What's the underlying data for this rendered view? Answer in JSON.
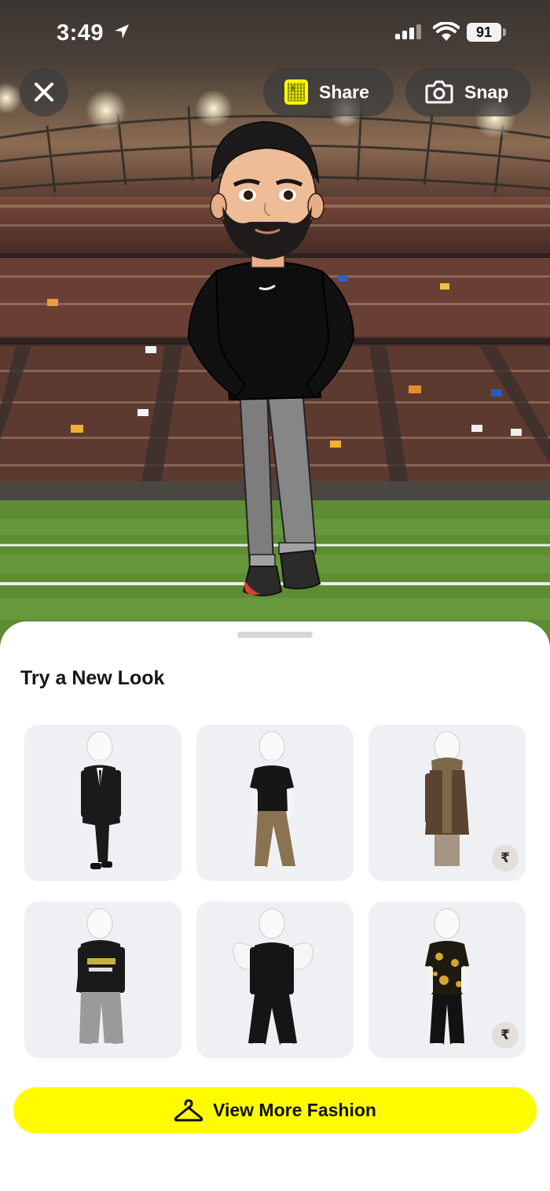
{
  "status_bar": {
    "time": "3:49",
    "battery": "91"
  },
  "top_controls": {
    "share_label": "Share",
    "snap_label": "Snap"
  },
  "sheet": {
    "title": "Try a New Look",
    "outfits": [
      {
        "name": "black suit",
        "premium": false
      },
      {
        "name": "black polo with khaki pants",
        "premium": false
      },
      {
        "name": "brown coat with scarf",
        "premium": true,
        "price_symbol": "₹"
      },
      {
        "name": "racing jacket with baggy jeans",
        "premium": false
      },
      {
        "name": "black outfit with angel wings",
        "premium": false
      },
      {
        "name": "black and gold baroque shirt",
        "premium": true,
        "price_symbol": "₹"
      }
    ],
    "cta_label": "View More Fashion"
  },
  "colors": {
    "accent_yellow": "#fffc00",
    "card_bg": "#eff0f4"
  }
}
